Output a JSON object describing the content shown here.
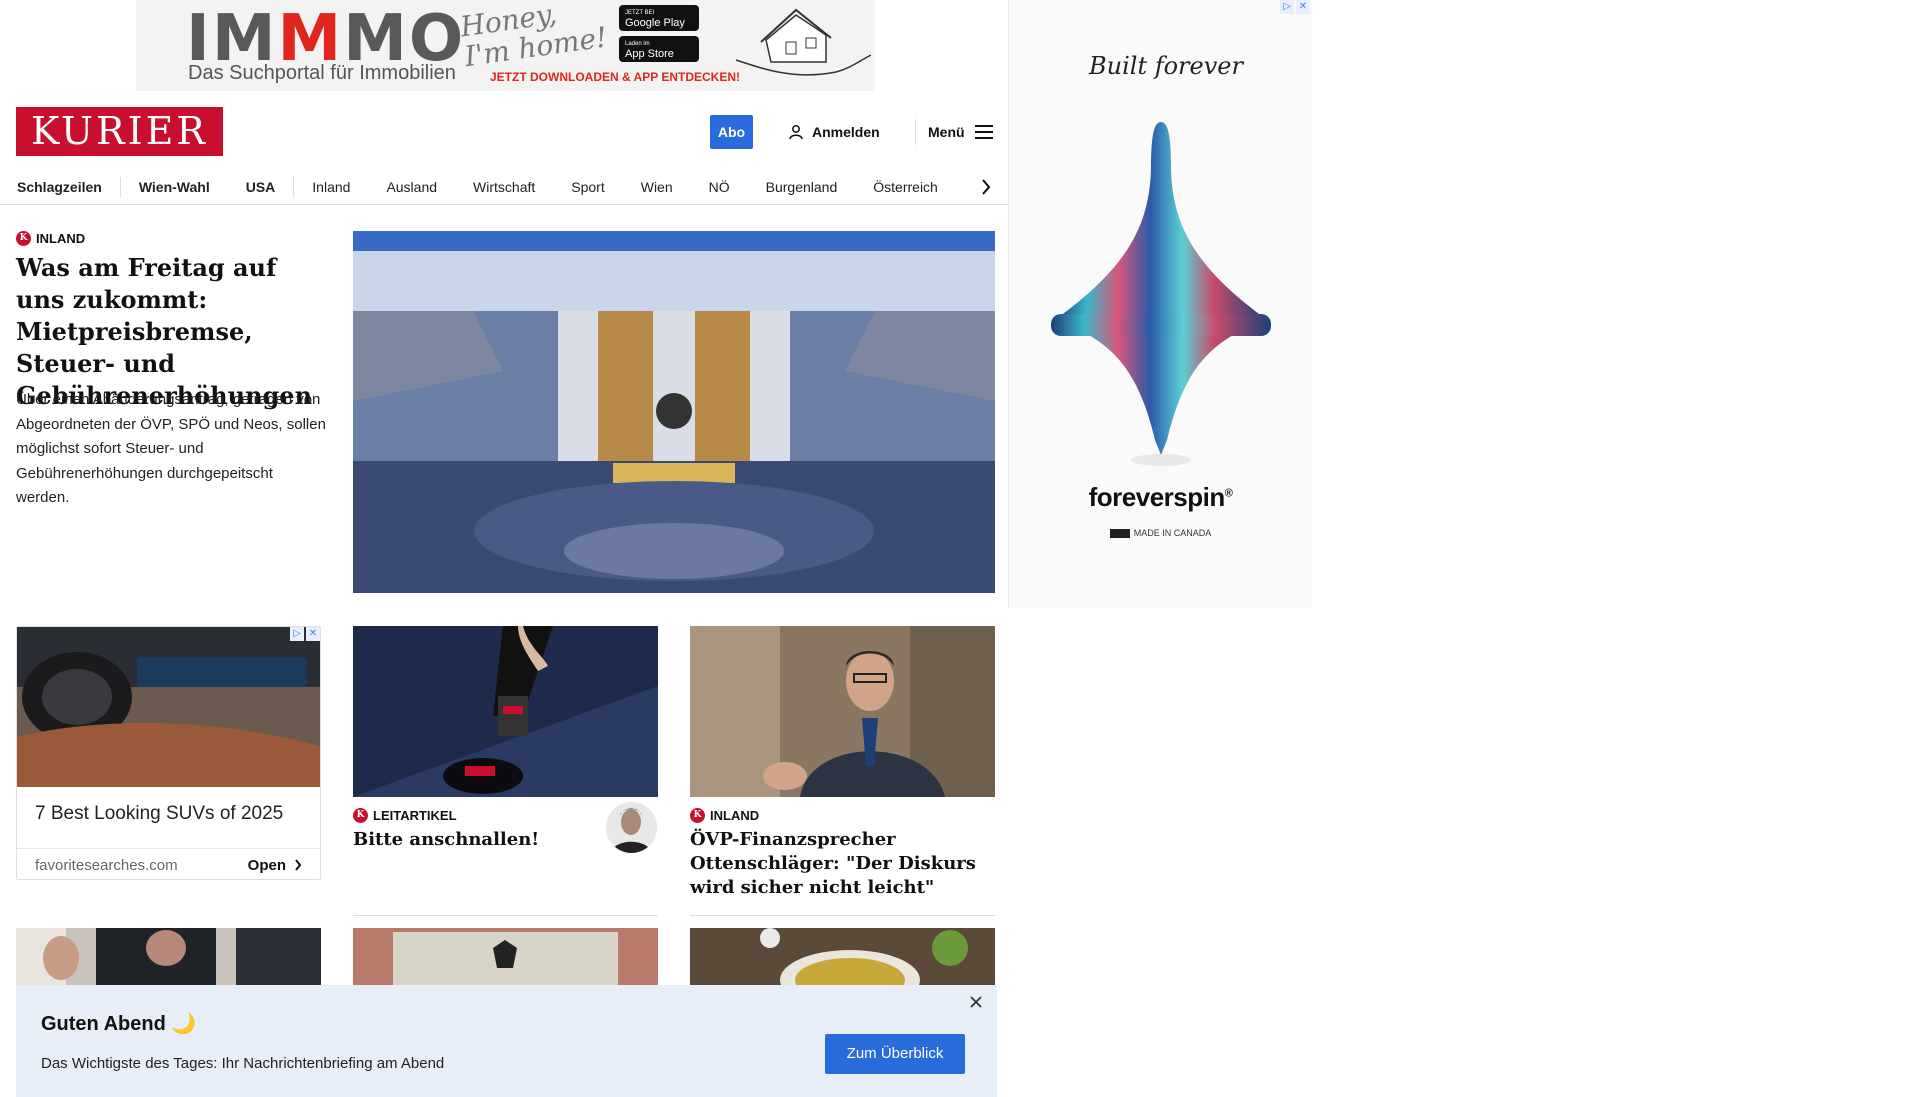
{
  "top_ad": {
    "brand_prefix": "IM",
    "brand_accent": "M",
    "brand_suffix": "MO",
    "tagline": "Das Suchportal für Immobilien",
    "script_text": "Honey, I'm home!",
    "google_play_small": "JETZT BEI",
    "google_play": "Google Play",
    "app_store_small": "Laden im",
    "app_store": "App Store",
    "cta": "JETZT DOWNLOADEN & APP ENTDECKEN!"
  },
  "side_ad": {
    "signature": "Built forever",
    "brand": "foreverspin",
    "registered": "®",
    "made_in": "MADE IN CANADA"
  },
  "header": {
    "logo": "KURIER",
    "abo_label": "Abo",
    "login_label": "Anmelden",
    "menu_label": "Menü"
  },
  "nav": {
    "items": [
      "Schlagzeilen",
      "Wien-Wahl",
      "USA",
      "Inland",
      "Ausland",
      "Wirtschaft",
      "Sport",
      "Wien",
      "NÖ",
      "Burgenland",
      "Österreich"
    ]
  },
  "lead": {
    "kicker": "INLAND",
    "title": "Was am Freitag auf uns zukommt: Mietpreisbremse, Steuer- und Gebührenerhöhungen",
    "teaser": "Über einen Abänderungsantrag, getragen von Abgeordneten der ÖVP, SPÖ und Neos, sollen möglichst sofort Steuer- und Gebührenerhöhungen durchgepeitscht werden."
  },
  "ad_card": {
    "title": "7 Best Looking SUVs of 2025",
    "domain": "favoritesearches.com",
    "open_label": "Open"
  },
  "cards": [
    {
      "kicker": "LEITARTIKEL",
      "title": "Bitte anschnallen!"
    },
    {
      "kicker": "INLAND",
      "title": "ÖVP-Finanzsprecher Ottenschläger: \"Der Diskurs wird sicher nicht leicht\""
    }
  ],
  "notification": {
    "title": "Guten Abend 🌙",
    "text": "Das Wichtigste des Tages: Ihr Nachrichtenbriefing am Abend",
    "button": "Zum Überblick"
  },
  "colors": {
    "brand_red": "#c8102e",
    "accent_blue": "#2a6bdc",
    "notify_bg": "#e7eef8"
  }
}
